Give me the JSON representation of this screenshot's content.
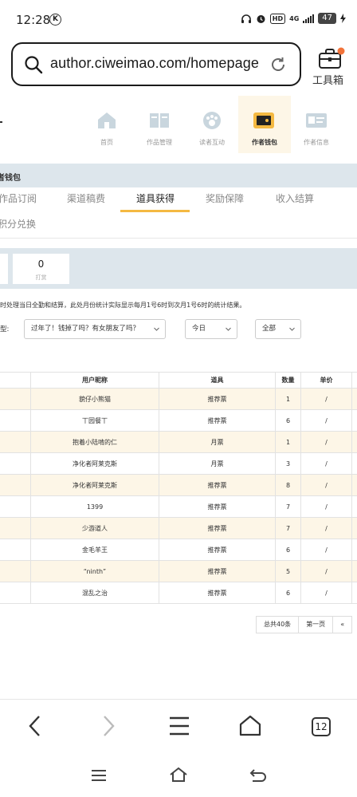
{
  "status_bar": {
    "time": "12:28",
    "k_badge": "K",
    "hd": "HD",
    "net": "4G",
    "battery": "47"
  },
  "browser": {
    "url": "author.ciweimao.com/homepage",
    "toolbox_label": "工具箱",
    "tab_count": "12"
  },
  "nav": [
    {
      "label": "首页"
    },
    {
      "label": "作品管理"
    },
    {
      "label": "读者互动"
    },
    {
      "label": "作者钱包"
    },
    {
      "label": "作者信息"
    }
  ],
  "wallet_title": "者钱包",
  "subtabs": [
    "作品订阅",
    "渠道稿费",
    "道具获得",
    "奖励保障",
    "收入结算"
  ],
  "subtab_exchange": "积分兑换",
  "stats": {
    "value": "0",
    "label": "打赏"
  },
  "notice": "时处理当日全勤和结算，此处月份统计实际显示每月1号6时到次月1号6时的统计结果。",
  "filters": {
    "type_label": "型:",
    "book": "过年了！钱掉了吗？有女朋友了吗？",
    "date": "今日",
    "kind": "全部"
  },
  "table": {
    "headers": [
      "用户昵称",
      "道具",
      "数量",
      "单价"
    ],
    "rows": [
      [
        "貌仔小熊猫",
        "推荐票",
        "1",
        "/"
      ],
      [
        "丅园餐丅",
        "推荐票",
        "6",
        "/"
      ],
      [
        "抱着小陆啃的仁",
        "月票",
        "1",
        "/"
      ],
      [
        "净化者阿莱克斯",
        "月票",
        "3",
        "/"
      ],
      [
        "净化者阿莱克斯",
        "推荐票",
        "8",
        "/"
      ],
      [
        "1399",
        "推荐票",
        "7",
        "/"
      ],
      [
        "少游道人",
        "推荐票",
        "7",
        "/"
      ],
      [
        "金毛羊王",
        "推荐票",
        "6",
        "/"
      ],
      [
        "“ninth”",
        "推荐票",
        "5",
        "/"
      ],
      [
        "混乱之治",
        "推荐票",
        "6",
        "/"
      ]
    ]
  },
  "pager": {
    "total": "总共40条",
    "first": "第一页",
    "prev": "«"
  },
  "colors": {
    "accent": "#f4b942",
    "band": "#dde6ec",
    "row_highlight": "#fdf6e7",
    "badge": "#f2733a"
  }
}
